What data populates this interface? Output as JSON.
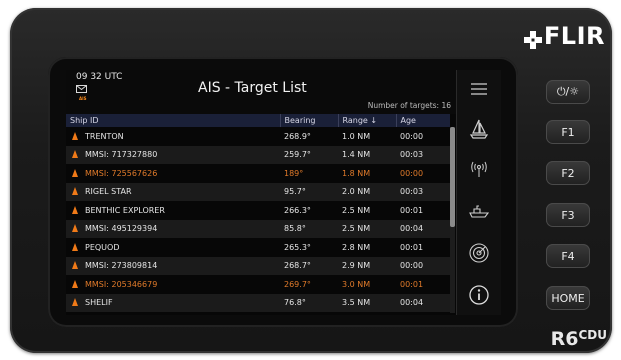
{
  "brand": {
    "name": "FLIR",
    "model": "R6",
    "model_suffix": "CDU"
  },
  "header": {
    "time": "09 32 UTC",
    "title": "AIS - Target List",
    "target_count": "Number of targets: 16",
    "message_tag": "AIS"
  },
  "table": {
    "columns": [
      "Ship ID",
      "Bearing",
      "Range ↓",
      "Age"
    ],
    "rows": [
      {
        "ship_id": "TRENTON",
        "bearing": "268.9°",
        "range": "1.0 NM",
        "age": "00:00",
        "warn": false
      },
      {
        "ship_id": "MMSI: 717327880",
        "bearing": "259.7°",
        "range": "1.4 NM",
        "age": "00:03",
        "warn": false
      },
      {
        "ship_id": "MMSI: 725567626",
        "bearing": "189°",
        "range": "1.8 NM",
        "age": "00:00",
        "warn": true
      },
      {
        "ship_id": "RIGEL STAR",
        "bearing": "95.7°",
        "range": "2.0 NM",
        "age": "00:03",
        "warn": false
      },
      {
        "ship_id": "BENTHIC EXPLORER",
        "bearing": "266.3°",
        "range": "2.5 NM",
        "age": "00:01",
        "warn": false
      },
      {
        "ship_id": "MMSI: 495129394",
        "bearing": "85.8°",
        "range": "2.5 NM",
        "age": "00:04",
        "warn": false
      },
      {
        "ship_id": "PEQUOD",
        "bearing": "265.3°",
        "range": "2.8 NM",
        "age": "00:01",
        "warn": false
      },
      {
        "ship_id": "MMSI: 273809814",
        "bearing": "268.7°",
        "range": "2.9 NM",
        "age": "00:00",
        "warn": false
      },
      {
        "ship_id": "MMSI: 205346679",
        "bearing": "269.7°",
        "range": "3.0 NM",
        "age": "00:01",
        "warn": true
      },
      {
        "ship_id": "SHELIF",
        "bearing": "76.8°",
        "range": "3.5 NM",
        "age": "00:04",
        "warn": false
      }
    ]
  },
  "sidebar_icons": [
    "menu-icon",
    "sailboat-icon",
    "ais-radio-icon",
    "ship-icon",
    "radar-icon",
    "info-icon"
  ],
  "hardware_buttons": {
    "power": "⏻/☼",
    "f1": "F1",
    "f2": "F2",
    "f3": "F3",
    "f4": "F4",
    "home": "HOME"
  },
  "colors": {
    "warn": "#e07a2a",
    "target_icon": "#f07a18",
    "header_bg": "#1a2038"
  }
}
